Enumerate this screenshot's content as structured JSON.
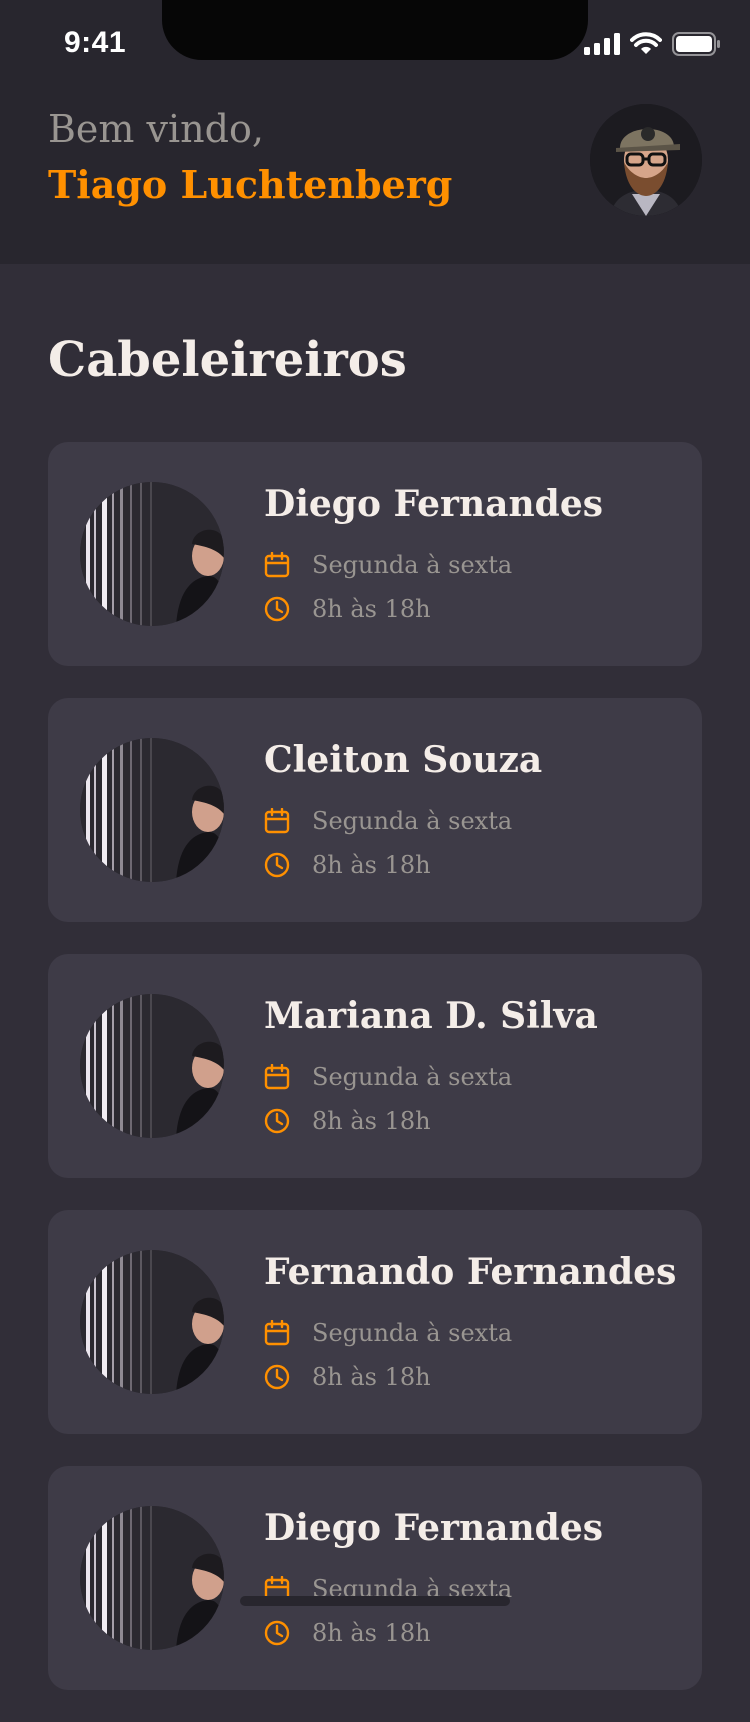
{
  "status_bar": {
    "time": "9:41",
    "icons": [
      "cellular-signal-icon",
      "wifi-icon",
      "battery-icon"
    ]
  },
  "header": {
    "welcome": "Bem vindo,",
    "user_name": "Tiago Luchtenberg",
    "avatar": "user-avatar"
  },
  "section_title": "Cabeleireiros",
  "providers": [
    {
      "name": "Diego Fernandes",
      "days": "Segunda à sexta",
      "hours": "8h às 18h"
    },
    {
      "name": "Cleiton Souza",
      "days": "Segunda à sexta",
      "hours": "8h às 18h"
    },
    {
      "name": "Mariana D. Silva",
      "days": "Segunda à sexta",
      "hours": "8h às 18h"
    },
    {
      "name": "Fernando Fernandes",
      "days": "Segunda à sexta",
      "hours": "8h às 18h"
    },
    {
      "name": "Diego Fernandes",
      "days": "Segunda à sexta",
      "hours": "8h às 18h"
    }
  ],
  "icons": {
    "days": "calendar-icon",
    "hours": "clock-icon"
  },
  "colors": {
    "background": "#312e38",
    "header_background": "#28262e",
    "card_background": "#3e3b47",
    "accent": "#ff9000",
    "text_primary": "#f4ede8",
    "text_secondary": "#999591"
  }
}
